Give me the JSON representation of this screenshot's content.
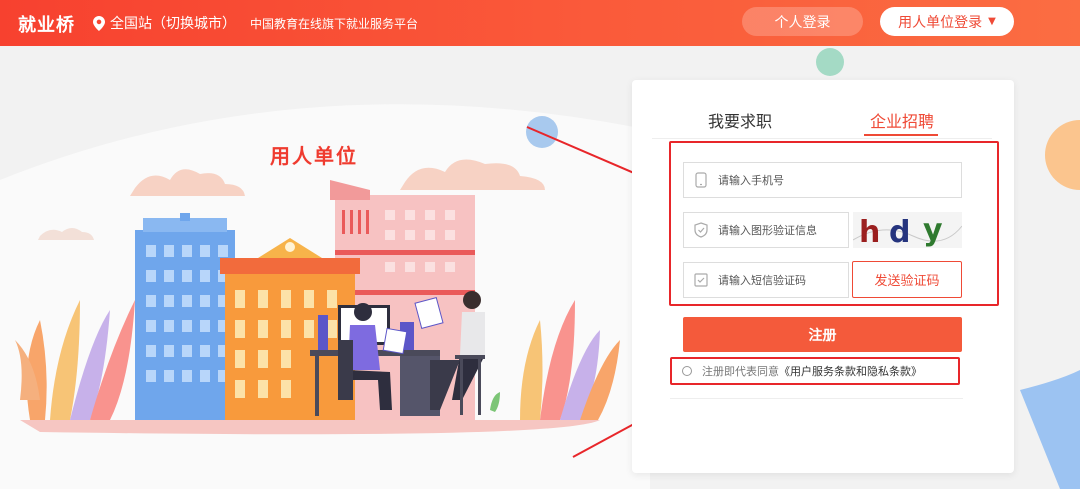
{
  "header": {
    "brand": "就业桥",
    "location": "全国站（切换城市）",
    "slogan": "中国教育在线旗下就业服务平台",
    "personal_login": "个人登录",
    "company_login": "用人单位登录",
    "company_caret": "▼"
  },
  "hero": {
    "title": "用人单位"
  },
  "panel": {
    "tabs": [
      "我要求职",
      "企业招聘"
    ],
    "active_tab": "企业招聘",
    "phone_placeholder": "请输入手机号",
    "captcha_placeholder": "请输入图形验证信息",
    "captcha_text": "hdy",
    "sms_placeholder": "请输入短信验证码",
    "send_code": "发送验证码",
    "register": "注册",
    "agree_prefix": "注册即代表同意",
    "agree_link": "《用户服务条款和隐私条款》"
  },
  "colors": {
    "brand_red": "#f7412f",
    "accent": "#ef4a36",
    "annotation_red": "#e8262a"
  }
}
